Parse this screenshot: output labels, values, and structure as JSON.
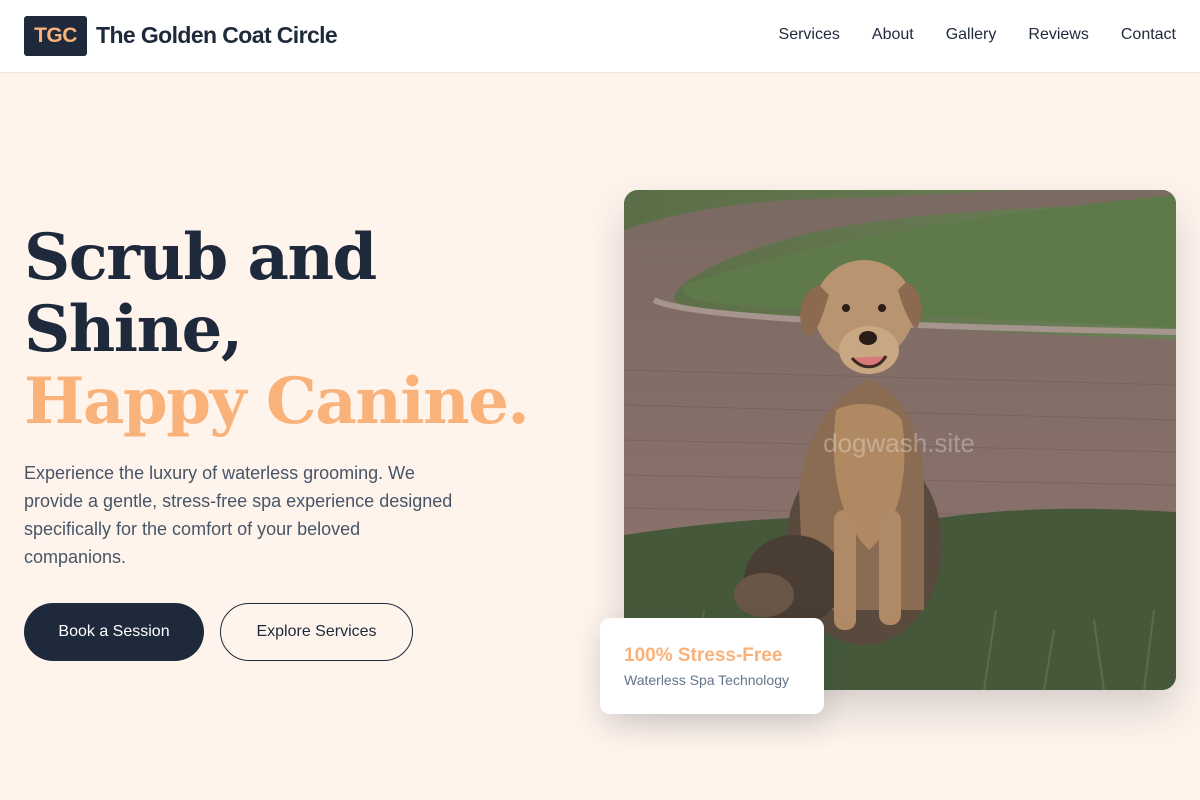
{
  "header": {
    "logo_text": "TGC",
    "brand_name": "The Golden Coat Circle",
    "nav": [
      "Services",
      "About",
      "Gallery",
      "Reviews",
      "Contact"
    ]
  },
  "hero": {
    "title_line1": "Scrub and",
    "title_line2": "Shine,",
    "title_accent": "Happy Canine.",
    "description": "Experience the luxury of waterless grooming. We provide a gentle, stress-free spa experience designed specifically for the comfort of your beloved companions.",
    "primary_button": "Book a Session",
    "secondary_button": "Explore Services",
    "image_watermark": "dogwash.site"
  },
  "badge": {
    "title": "100% Stress-Free",
    "subtitle": "Waterless Spa Technology"
  },
  "colors": {
    "navy": "#1e293b",
    "accent_peach": "#f9b27a",
    "background": "#fff4ec",
    "muted_text": "#475569"
  },
  "icons": {
    "hero_image": "dog-photo"
  }
}
